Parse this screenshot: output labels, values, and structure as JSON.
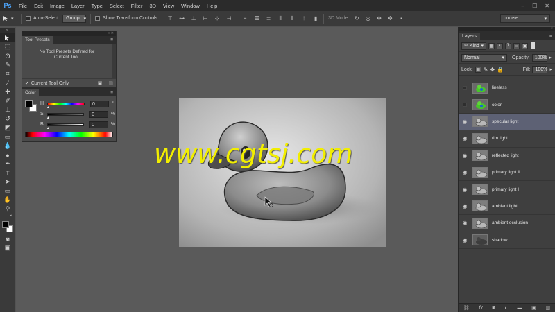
{
  "app": {
    "logo": "Ps"
  },
  "menu": [
    "File",
    "Edit",
    "Image",
    "Layer",
    "Type",
    "Select",
    "Filter",
    "3D",
    "View",
    "Window",
    "Help"
  ],
  "window_controls": [
    "–",
    "☐",
    "✕"
  ],
  "options": {
    "auto_select_label": "Auto-Select:",
    "group_value": "Group",
    "transform_label": "Show Transform Controls",
    "mode_label": "3D Mode:",
    "workspace": "course"
  },
  "tool_presets": {
    "tab": "Tool Presets",
    "message": "No Tool Presets Defined for Current Tool.",
    "current_only": "Current Tool Only"
  },
  "color_panel": {
    "tab": "Color",
    "channels": [
      {
        "label": "H",
        "value": "0",
        "unit": "°"
      },
      {
        "label": "S",
        "value": "0",
        "unit": "%"
      },
      {
        "label": "B",
        "value": "0",
        "unit": "%"
      }
    ]
  },
  "watermark": "www.cgtsj.com",
  "layers": {
    "tab": "Layers",
    "filter": "Kind",
    "blend_mode": "Normal",
    "opacity_label": "Opacity:",
    "opacity_value": "100%",
    "lock_label": "Lock:",
    "fill_label": "Fill:",
    "fill_value": "100%",
    "items": [
      {
        "name": "lineless",
        "visible": false,
        "selected": false,
        "thumb": "color"
      },
      {
        "name": "color",
        "visible": false,
        "selected": false,
        "thumb": "color"
      },
      {
        "name": "specular light",
        "visible": true,
        "selected": true,
        "thumb": "gray"
      },
      {
        "name": "rim light",
        "visible": true,
        "selected": false,
        "thumb": "gray"
      },
      {
        "name": "reflected light",
        "visible": true,
        "selected": false,
        "thumb": "gray"
      },
      {
        "name": "primary light II",
        "visible": true,
        "selected": false,
        "thumb": "gray"
      },
      {
        "name": "primary light I",
        "visible": true,
        "selected": false,
        "thumb": "gray"
      },
      {
        "name": "ambient light",
        "visible": true,
        "selected": false,
        "thumb": "gray"
      },
      {
        "name": "ambient occlusion",
        "visible": true,
        "selected": false,
        "thumb": "gray"
      },
      {
        "name": "shadow",
        "visible": true,
        "selected": false,
        "thumb": "dark"
      }
    ]
  },
  "colors": {
    "selected_layer": "#5d6174",
    "watermark": "#f2ee00",
    "logo": "#4ea7ff"
  }
}
